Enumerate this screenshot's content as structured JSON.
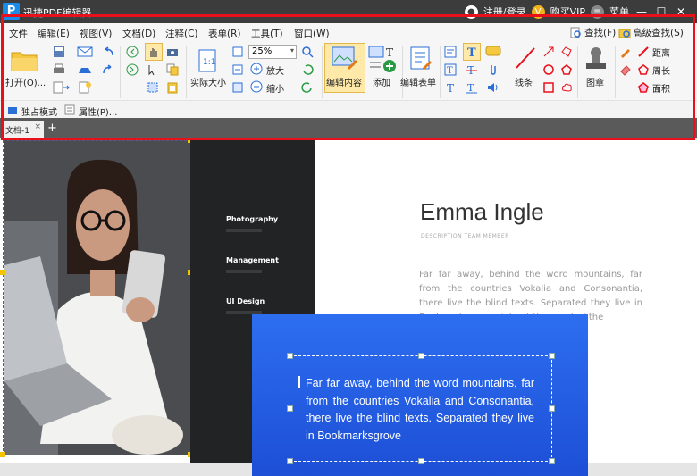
{
  "titlebar": {
    "app_title": "迅捷PDF编辑器",
    "logo_glyph": "P",
    "login_label": "注册/登录",
    "vip_label": "购买VIP",
    "menu_label": "菜单",
    "minimize": "—",
    "maximize": "☐",
    "close": "✕"
  },
  "menubar": {
    "items": [
      "文件",
      "编辑(E)",
      "视图(V)",
      "文档(D)",
      "注释(C)",
      "表单(R)",
      "工具(T)",
      "窗口(W)"
    ],
    "find_label": "查找(F)",
    "advanced_find_label": "高级查找(S)"
  },
  "ribbon": {
    "open_label": "打开(O)...",
    "actual_size_label": "实际大小",
    "zoom_value": "25%",
    "zoom_in_label": "放大",
    "zoom_out_label": "缩小",
    "edit_content_label": "编辑内容",
    "add_label": "添加",
    "edit_form_label": "编辑表单",
    "line_label": "线条",
    "stamp_label": "图章",
    "distance_label": "距离",
    "perimeter_label": "周长",
    "area_label": "面积",
    "exclusive_mode_label": "独占模式",
    "properties_label": "属性(P)..."
  },
  "tabs": {
    "doc_tab_label": "文档-1",
    "close_glyph": "×",
    "add_glyph": "+"
  },
  "document": {
    "nav_items": [
      "Photography",
      "Management",
      "UI Design"
    ],
    "name": "Emma Ingle",
    "description": "DESCRIPTION TEAM MEMBER",
    "body_text": "Far far away, behind the word mountains, far from the countries Vokalia and Consonantia, there live the blind texts. Separated they live in Bookmarksgrove right at the coast of the",
    "blue_text": "Far far away, behind the word mountains, far from the countries Vokalia and Consonantia, there live the blind texts. Separated they live in Bookmarksgrove"
  },
  "colors": {
    "highlight_border": "#e8101b",
    "accent_blue": "#1d4fd6",
    "titlebar_bg": "#3c3c3c"
  }
}
